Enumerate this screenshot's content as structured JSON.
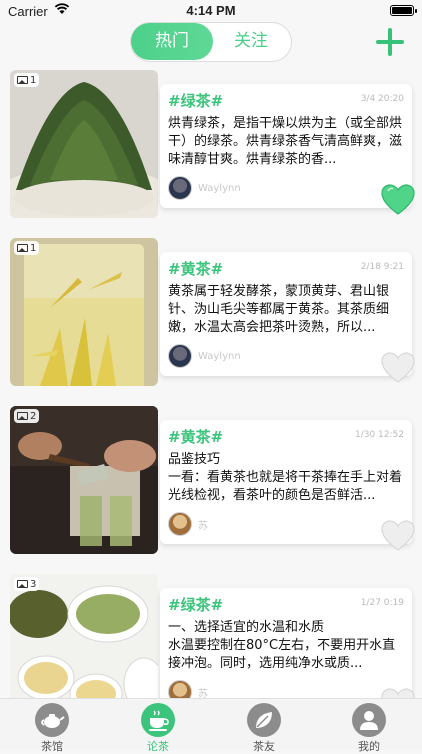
{
  "status": {
    "carrier": "Carrier",
    "time": "4:14 PM"
  },
  "segment": {
    "hot": "热门",
    "follow": "关注"
  },
  "posts": [
    {
      "count": "1",
      "tag": "#绿茶#",
      "date": "3/4 20:20",
      "text": "烘青绿茶，是指干燥以烘为主（或全部烘干）的绿茶。烘青绿茶香气清高鲜爽，滋味清醇甘爽。烘青绿茶的香...",
      "author": "Waylynn",
      "liked": true
    },
    {
      "count": "1",
      "tag": "#黄茶#",
      "date": "2/18 9:21",
      "text": "黄茶属于轻发酵茶，蒙顶黄芽、君山银针、沩山毛尖等都属于黄茶。其茶质细嫩，水温太高会把茶叶烫熟，所以...",
      "author": "Waylynn",
      "liked": false
    },
    {
      "count": "2",
      "tag": "#黄茶#",
      "date": "1/30 12:52",
      "text": "品鉴技巧\n一看：看黄茶也就是将干茶捧在手上对着光线检视，看茶叶的颜色是否鲜活...",
      "author": "苏",
      "liked": false
    },
    {
      "count": "3",
      "tag": "#绿茶#",
      "date": "1/27 0:19",
      "text": "一、选择适宜的水温和水质\n水温要控制在80°C左右，不要用开水直接冲泡。同时，选用纯净水或质...",
      "author": "苏",
      "liked": false
    }
  ],
  "tabs": [
    {
      "label": "茶馆",
      "icon": "teapot-icon"
    },
    {
      "label": "论茶",
      "icon": "tea-cup-icon"
    },
    {
      "label": "茶友",
      "icon": "leaf-icon"
    },
    {
      "label": "我的",
      "icon": "person-icon"
    }
  ],
  "colors": {
    "accent": "#3cc47c",
    "heart_liked": "#4fd48a",
    "heart_unliked": "#e6e6e6"
  }
}
